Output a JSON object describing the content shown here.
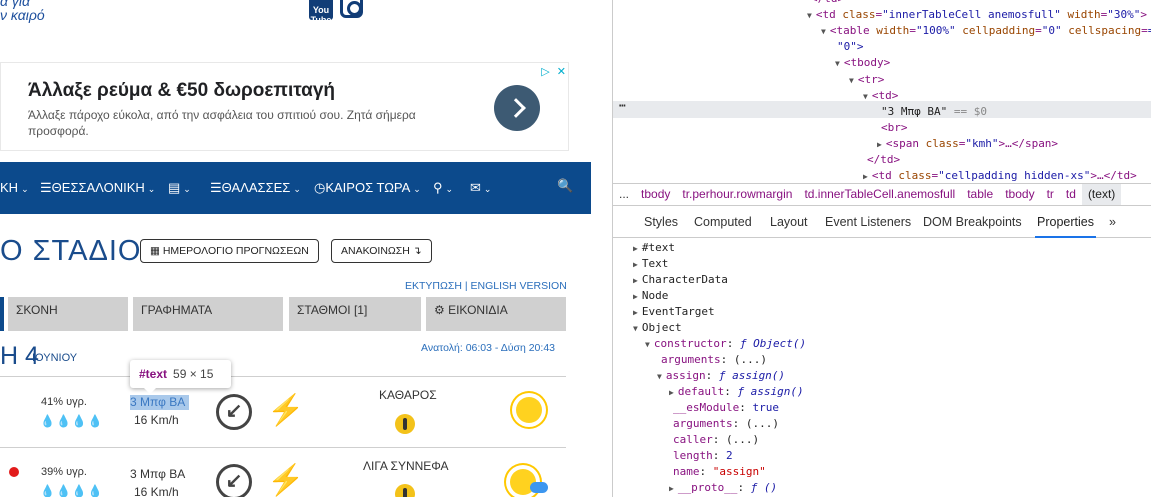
{
  "site": {
    "tagline_line1": "α για",
    "tagline_line2": "ν καιρό",
    "youtube_label": "You Tube"
  },
  "ad": {
    "title": "Άλλαξε ρεύμα & €50 δωροεπιταγή",
    "description": "Άλλαξε πάροχο εύκολα, από την ασφάλεια του σπιτιού σου. Ζητά σήμερα προσφορά.",
    "choices_icon": "▷",
    "close_icon": "✕"
  },
  "nav": {
    "items": [
      {
        "label": "ΚΗ",
        "icon": ""
      },
      {
        "label": "ΘΕΣΣΑΛΟΝΙΚΗ",
        "icon": "☰"
      },
      {
        "label": "",
        "icon": "▤"
      },
      {
        "label": "ΘΑΛΑΣΣΕΣ",
        "icon": "☰"
      },
      {
        "label": "ΚΑΙΡΟΣ ΤΩΡΑ",
        "icon": "◷"
      },
      {
        "label": "",
        "icon": "⚲"
      },
      {
        "label": "",
        "icon": "✉"
      }
    ],
    "caret": "⌄",
    "search_icon": "🔍"
  },
  "heading": {
    "title": "Ο ΣΤΑΔΙΟ",
    "calendar_button": "ΗΜΕΡΟΛΟΓΙΟ ΠΡΟΓΝΩΣΕΩΝ",
    "announce_button": "ΑΝΑΚΟΙΝΩΣΗ ↴",
    "print_link": "ΕΚΤΥΠΩΣΗ",
    "separator": "|",
    "english_link": "ENGLISH VERSION"
  },
  "tabs": [
    {
      "label": "ΣΚΟΝΗ"
    },
    {
      "label": "ΓΡΑΦΗΜΑΤΑ"
    },
    {
      "label": "ΣΤΑΘΜΟΙ  [1]"
    },
    {
      "label": "⚙ ΕΙΚΟΝΙΔΙΑ"
    }
  ],
  "day": {
    "big": "Η 4",
    "month": "ΙΟΥΝΙΟΥ",
    "sun_times": "Ανατολή: 06:03  -  Δύση 20:43"
  },
  "rows": [
    {
      "humidity": "41% υγρ.",
      "drops_filled": 3,
      "drops_total": 4,
      "wind_bf": "3 Μπφ ΒΑ",
      "wind_kmh": "16 Km/h",
      "sky": "ΚΑΘΑΡΟΣ",
      "weather_icon": "sun"
    },
    {
      "humidity": "39% υγρ.",
      "drops_filled": 3,
      "drops_total": 4,
      "wind_bf": "3 Μπφ ΒΑ",
      "wind_kmh": "16 Km/h",
      "sky": "ΛΙΓΑ ΣΥΝΝΕΦΑ",
      "weather_icon": "sun-cloud"
    }
  ],
  "tooltip": {
    "node": "#text",
    "size": "59 × 15"
  },
  "devtools": {
    "dom_lines": [
      {
        "indent": 0,
        "text": "</td>"
      },
      {
        "indent": 0,
        "tri": "▼",
        "tag": "<td ",
        "attrs": [
          {
            "n": "class",
            "v": "\"innerTableCell anemosfull\""
          },
          {
            "n": "width",
            "v": "\"30%\""
          }
        ],
        "end": ">"
      },
      {
        "indent": 1,
        "tri": "▼",
        "tag": "<table ",
        "attrs": [
          {
            "n": "width",
            "v": "\"100%\""
          },
          {
            "n": "cellpadding",
            "v": "\"0\""
          },
          {
            "n": "cellspacing",
            "v": "="
          }
        ],
        "end": ""
      },
      {
        "indent": 1,
        "plain": "\"0\">"
      },
      {
        "indent": 2,
        "tri": "▼",
        "tag": "<tbody>"
      },
      {
        "indent": 3,
        "tri": "▼",
        "tag": "<tr>"
      },
      {
        "indent": 4,
        "tri": "▼",
        "tag": "<td>"
      },
      {
        "indent": 5,
        "text_node": "\"3 Μπφ ΒΑ\"",
        "eq": "== $0"
      },
      {
        "indent": 5,
        "tag": "<br>"
      },
      {
        "indent": 5,
        "tri": "▶",
        "tag": "<span ",
        "attrs": [
          {
            "n": "class",
            "v": "\"kmh\""
          }
        ],
        "end": ">…</span>"
      },
      {
        "indent": 4,
        "tag": "</td>"
      },
      {
        "indent": 4,
        "tri": "▶",
        "tag": "<td ",
        "attrs": [
          {
            "n": "class",
            "v": "\"cellpadding hidden-xs\""
          }
        ],
        "end": ">…</td>"
      }
    ],
    "breadcrumbs": [
      "...",
      "tbody",
      "tr.perhour.rowmargin",
      "td.innerTableCell.anemosfull",
      "table",
      "tbody",
      "tr",
      "td",
      "(text)"
    ],
    "tabs": [
      "Styles",
      "Computed",
      "Layout",
      "Event Listeners",
      "DOM Breakpoints",
      "Properties",
      "»"
    ],
    "active_tab": "Properties",
    "properties": [
      {
        "indent": 0,
        "tri": "▶",
        "key": "#text"
      },
      {
        "indent": 0,
        "tri": "▶",
        "key": "Text"
      },
      {
        "indent": 0,
        "tri": "▶",
        "key": "CharacterData"
      },
      {
        "indent": 0,
        "tri": "▶",
        "key": "Node"
      },
      {
        "indent": 0,
        "tri": "▶",
        "key": "EventTarget"
      },
      {
        "indent": 0,
        "tri": "▼",
        "key": "Object"
      },
      {
        "indent": 1,
        "tri": "▼",
        "key": "constructor",
        "val": "ƒ Object()",
        "kind": "f"
      },
      {
        "indent": 2,
        "key": "arguments",
        "val": "(...)",
        "kind": "plain"
      },
      {
        "indent": 2,
        "tri": "▼",
        "key": "assign",
        "val": "ƒ assign()",
        "kind": "f"
      },
      {
        "indent": 3,
        "tri": "▶",
        "key": "default",
        "val": "ƒ assign()",
        "kind": "f"
      },
      {
        "indent": 3,
        "key": "__esModule",
        "val": "true",
        "kind": "b"
      },
      {
        "indent": 3,
        "key": "arguments",
        "val": "(...)",
        "kind": "plain"
      },
      {
        "indent": 3,
        "key": "caller",
        "val": "(...)",
        "kind": "plain"
      },
      {
        "indent": 3,
        "key": "length",
        "val": "2",
        "kind": "n"
      },
      {
        "indent": 3,
        "key": "name",
        "val": "\"assign\"",
        "kind": "s"
      },
      {
        "indent": 3,
        "tri": "▶",
        "key": "__proto__",
        "val": "ƒ ()",
        "kind": "f"
      }
    ]
  },
  "colors": {
    "nav_bg": "#0c4a8c",
    "brand_text": "#1a4c8c",
    "tab_bg": "#d0d0d0",
    "selection": "#a9c9eb",
    "devtools_tag": "#881280",
    "devtools_active_tab": "#1a73e8"
  }
}
